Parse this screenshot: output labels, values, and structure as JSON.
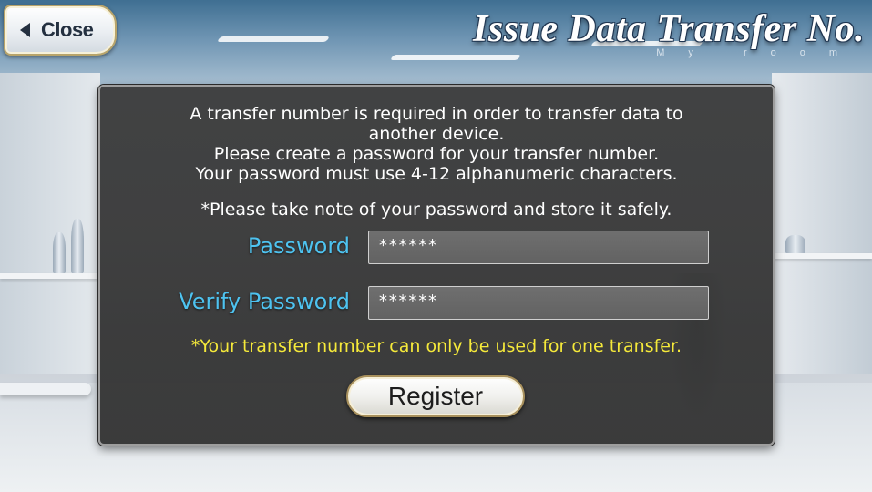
{
  "header": {
    "close_label": "Close",
    "title": "Issue Data Transfer No.",
    "subtitle": "My room"
  },
  "dialog": {
    "info_lines": [
      "A transfer number is required in order to transfer data to",
      "another device.",
      "Please create a password for your transfer number.",
      "Your password must use 4-12 alphanumeric characters."
    ],
    "note": "*Please take note of your password and store it safely.",
    "password": {
      "label": "Password",
      "value": "******"
    },
    "verify_password": {
      "label": "Verify Password",
      "value": "******"
    },
    "warning": "*Your transfer number can only be used for one transfer.",
    "register_label": "Register"
  },
  "colors": {
    "field_label": "#4ec3f0",
    "warning_text": "#f5e93a",
    "dialog_bg": "#3a3a3a"
  },
  "icons": {
    "close_button_icon": "back-arrow-icon"
  }
}
